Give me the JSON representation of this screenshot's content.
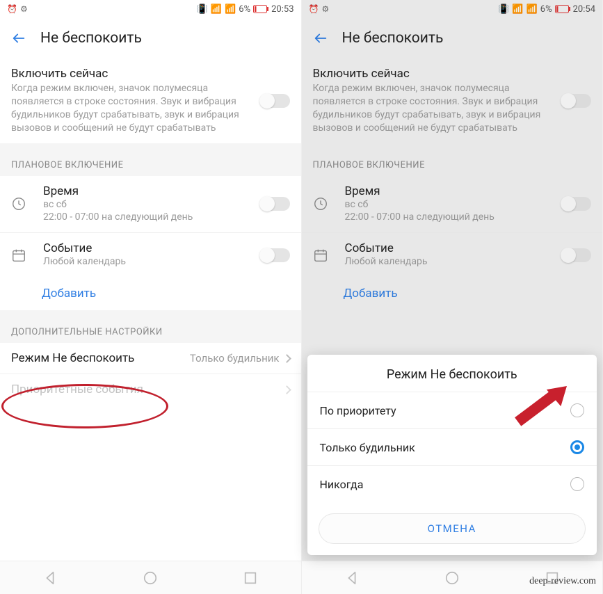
{
  "left": {
    "status": {
      "battery": "6%",
      "time": "20:53"
    },
    "header": {
      "title": "Не беспокоить"
    },
    "turn_on": {
      "title": "Включить сейчас",
      "desc": "Когда режим включен, значок полумесяца появляется в строке состояния. Звук и вибрация будильников будут срабатывать, звук и вибрация вызовов и сообщений не будут срабатывать"
    },
    "scheduled_hdr": "ПЛАНОВОЕ ВКЛЮЧЕНИЕ",
    "time_row": {
      "title": "Время",
      "sub1": "вс сб",
      "sub2": "22:00 - 07:00 на следующий день"
    },
    "event_row": {
      "title": "Событие",
      "sub": "Любой календарь"
    },
    "add": "Добавить",
    "more_hdr": "ДОПОЛНИТЕЛЬНЫЕ НАСТРОЙКИ",
    "mode_row": {
      "title": "Режим Не беспокоить",
      "value": "Только будильник"
    },
    "priority_row": {
      "title": "Приоритетные события"
    }
  },
  "right": {
    "status": {
      "battery": "6%",
      "time": "20:54"
    },
    "header": {
      "title": "Не беспокоить"
    },
    "turn_on": {
      "title": "Включить сейчас",
      "desc": "Когда режим включен, значок полумесяца появляется в строке состояния. Звук и вибрация будильников будут срабатывать, звук и вибрация вызовов и сообщений не будут срабатывать"
    },
    "scheduled_hdr": "ПЛАНОВОЕ ВКЛЮЧЕНИЕ",
    "time_row": {
      "title": "Время",
      "sub1": "вс сб",
      "sub2": "22:00 - 07:00 на следующий день"
    },
    "event_row": {
      "title": "Событие",
      "sub": "Любой календарь"
    },
    "add": "Добавить",
    "modal": {
      "title": "Режим Не беспокоить",
      "opt1": "По приоритету",
      "opt2": "Только будильник",
      "opt3": "Никогда",
      "cancel": "ОТМЕНА"
    }
  },
  "watermark": "deep-review.com"
}
